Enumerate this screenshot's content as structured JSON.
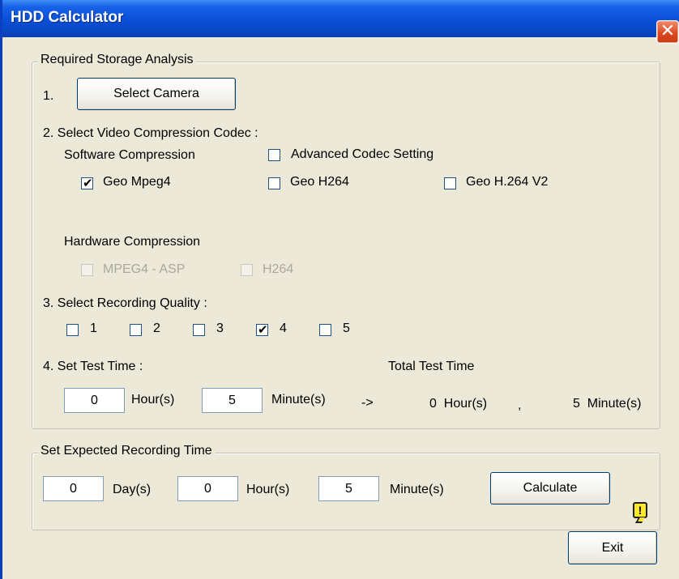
{
  "window": {
    "title": "HDD Calculator",
    "close_glyph": "✕"
  },
  "storage_group": {
    "legend": "Required Storage Analysis",
    "step1": {
      "label": "1.",
      "button": "Select Camera"
    },
    "step2": {
      "label": "2. Select Video Compression Codec :",
      "software_label": "Software Compression",
      "advanced": {
        "label": "Advanced Codec Setting",
        "checked": false
      },
      "codecs": [
        {
          "label": "Geo Mpeg4",
          "checked": true
        },
        {
          "label": "Geo H264",
          "checked": false
        },
        {
          "label": "Geo H.264 V2",
          "checked": false
        }
      ],
      "hardware_label": "Hardware Compression",
      "hardware_codecs": [
        {
          "label": "MPEG4 - ASP",
          "checked": false,
          "enabled": false
        },
        {
          "label": "H264",
          "checked": false,
          "enabled": false
        }
      ]
    },
    "step3": {
      "label": "3. Select Recording Quality :",
      "qualities": [
        {
          "label": "1",
          "checked": false
        },
        {
          "label": "2",
          "checked": false
        },
        {
          "label": "3",
          "checked": false
        },
        {
          "label": "4",
          "checked": true
        },
        {
          "label": "5",
          "checked": false
        }
      ]
    },
    "step4": {
      "label": "4. Set Test Time :",
      "total_label": "Total Test Time",
      "hours_value": "0",
      "hours_unit": "Hour(s)",
      "minutes_value": "5",
      "minutes_unit": "Minute(s)",
      "arrow": "->",
      "total_hours": "0  Hour(s)",
      "separator": ",",
      "total_minutes": "5  Minute(s)"
    }
  },
  "expected_group": {
    "legend": "Set Expected Recording Time",
    "days_value": "0",
    "days_unit": "Day(s)",
    "hours_value": "0",
    "hours_unit": "Hour(s)",
    "minutes_value": "5",
    "minutes_unit": "Minute(s)",
    "calculate_button": "Calculate",
    "warning_glyph": "!"
  },
  "exit_button": "Exit",
  "colors": {
    "titlebar": "#0a4fd6",
    "window_bg": "#ece9d8",
    "close": "#dc4a22",
    "warning": "#fde92a"
  }
}
